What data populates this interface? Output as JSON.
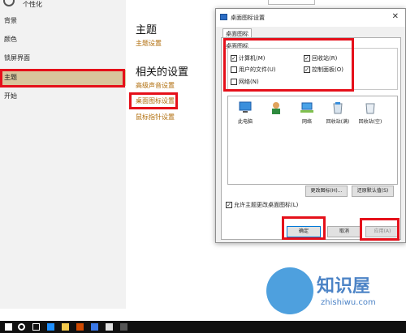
{
  "sidebar": {
    "title": "个性化",
    "items": [
      {
        "label": "背景"
      },
      {
        "label": "颜色"
      },
      {
        "label": "锁屏界面"
      },
      {
        "label": "主题"
      },
      {
        "label": "开始"
      }
    ]
  },
  "main": {
    "heading1": "主题",
    "theme_settings_link": "主题设置",
    "heading2": "相关的设置",
    "links": [
      "高级声音设置",
      "桌面图标设置",
      "鼠标指针设置"
    ]
  },
  "dialog": {
    "title": "桌面图标设置",
    "close_glyph": "✕",
    "tab_label": "桌面图标",
    "group_label": "桌面图标",
    "checkboxes": [
      {
        "label": "计算机(M)",
        "checked": true
      },
      {
        "label": "回收站(R)",
        "checked": true
      },
      {
        "label": "用户的文件(U)",
        "checked": false
      },
      {
        "label": "控制面板(O)",
        "checked": true
      },
      {
        "label": "网络(N)",
        "checked": false
      }
    ],
    "icons": [
      {
        "label": "此电脑",
        "icon": "computer-icon"
      },
      {
        "label": "",
        "icon": "user-files-icon"
      },
      {
        "label": "网络",
        "icon": "network-icon"
      },
      {
        "label": "回收站(满)",
        "icon": "recycle-bin-full-icon"
      },
      {
        "label": "回收站(空)",
        "icon": "recycle-bin-empty-icon"
      }
    ],
    "change_icon_button": "更改图标(H)...",
    "restore_default_button": "还原默认值(S)",
    "allow_themes_checkbox": {
      "label": "允许主题更改桌面图标(L)",
      "checked": true
    },
    "ok_button": "确定",
    "cancel_button": "取消",
    "apply_button": "应用(A)"
  },
  "watermark": {
    "text": "知识屋",
    "url": "zhishiwu.com"
  },
  "colors": {
    "accent": "#b06d0b",
    "active_nav": "#d8c59c",
    "annotation": "#e5101a",
    "taskbar": "#101010"
  }
}
